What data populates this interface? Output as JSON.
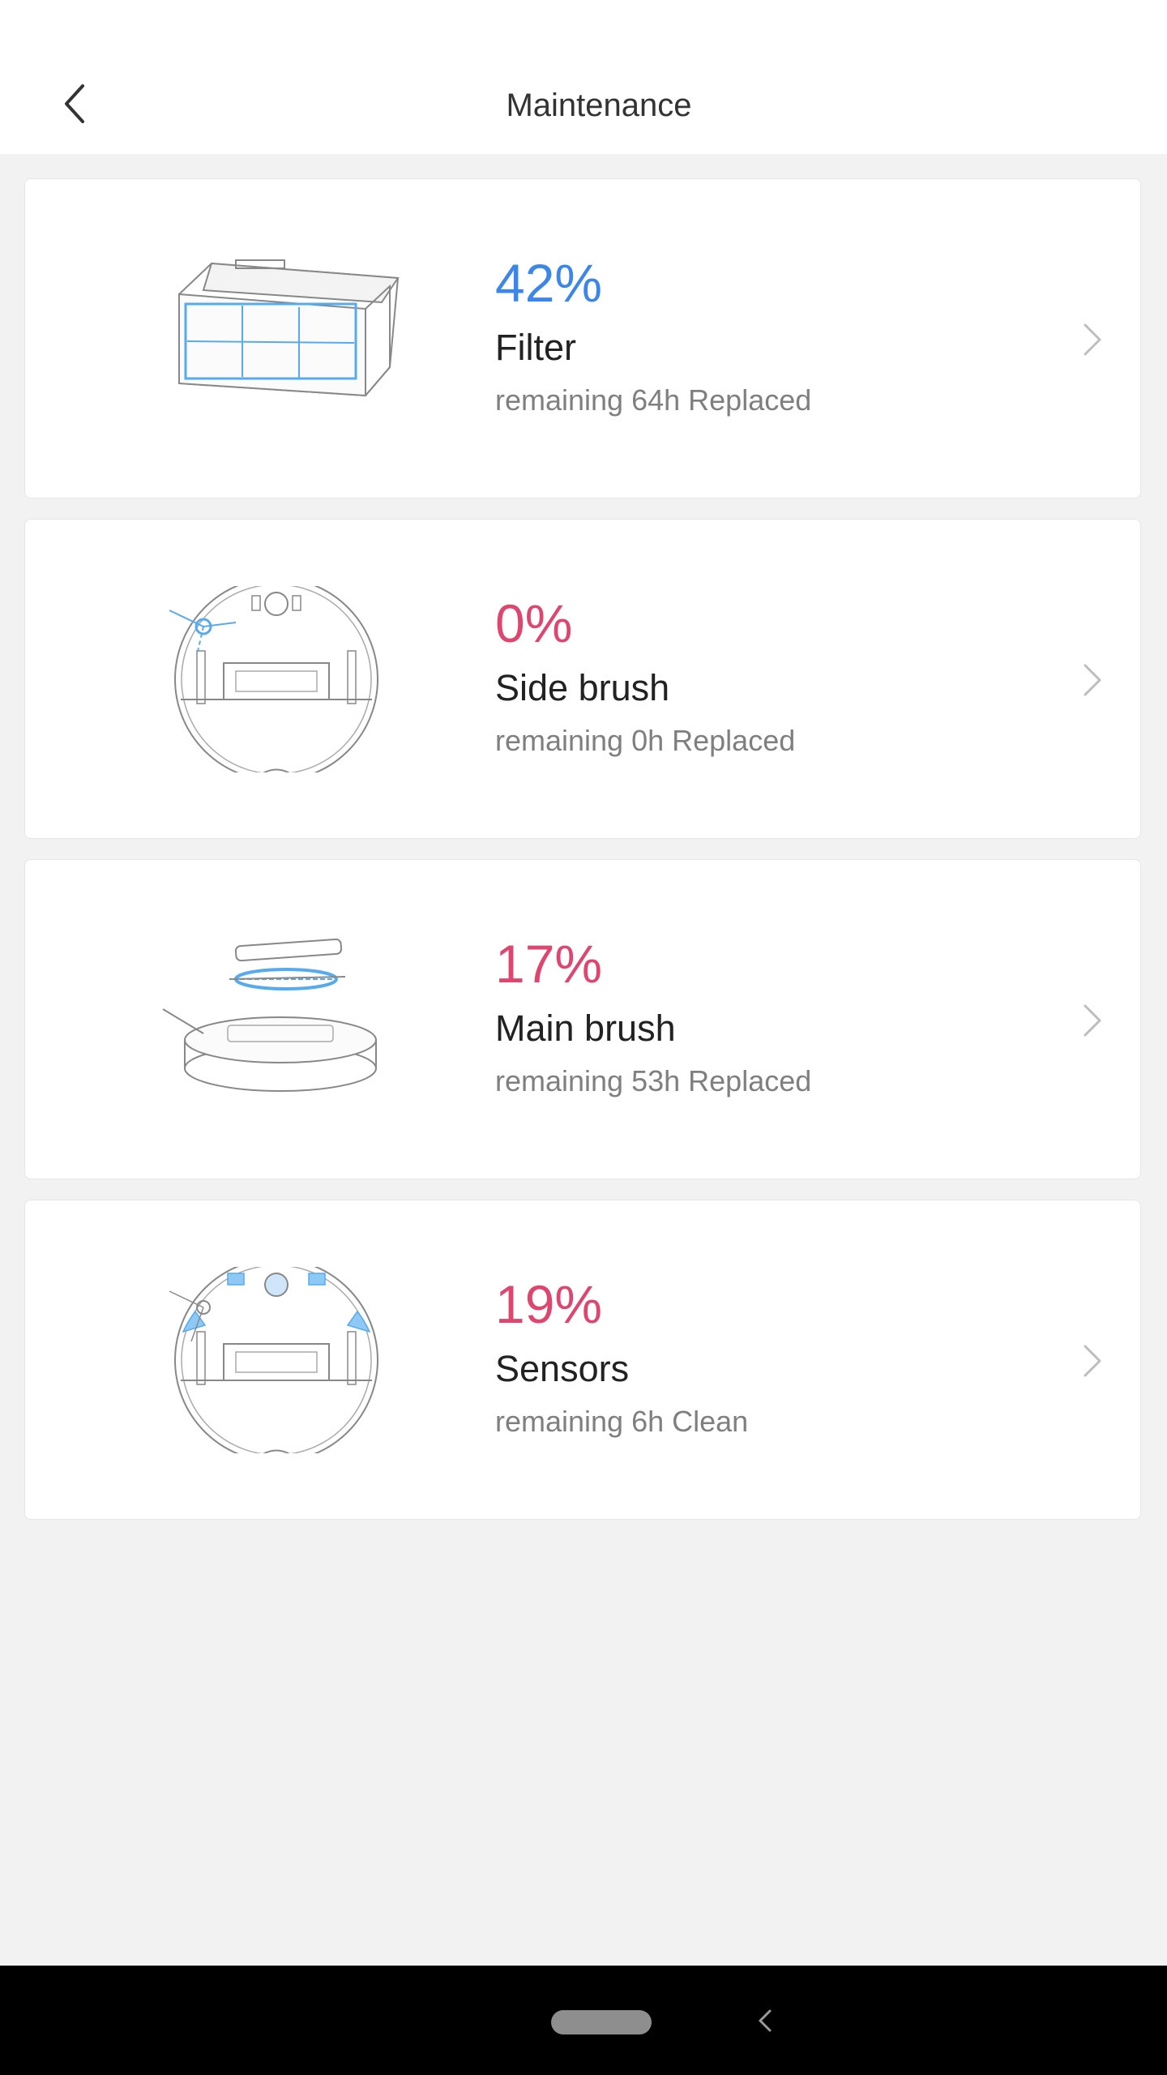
{
  "header": {
    "title": "Maintenance",
    "back_icon": "chevron-left-icon"
  },
  "items": [
    {
      "percent": "42%",
      "percent_value": 42,
      "name": "Filter",
      "detail": "remaining 64h Replaced",
      "status": "ok",
      "color": "#3b86ea",
      "illustration": "filter-illustration"
    },
    {
      "percent": "0%",
      "percent_value": 0,
      "name": "Side brush",
      "detail": "remaining 0h Replaced",
      "status": "low",
      "color": "#e0456f",
      "illustration": "side-brush-illustration"
    },
    {
      "percent": "17%",
      "percent_value": 17,
      "name": "Main brush",
      "detail": "remaining 53h Replaced",
      "status": "low",
      "color": "#e0456f",
      "illustration": "main-brush-illustration"
    },
    {
      "percent": "19%",
      "percent_value": 19,
      "name": "Sensors",
      "detail": "remaining 6h Clean",
      "status": "low",
      "color": "#e0456f",
      "illustration": "sensors-illustration"
    }
  ],
  "colors": {
    "ok": "#3b86ea",
    "low": "#e0456f",
    "background": "#f2f2f2",
    "accent_line": "#55aaf0"
  },
  "system_nav": {
    "home_icon": "home-pill-icon",
    "back_icon": "nav-back-icon"
  }
}
